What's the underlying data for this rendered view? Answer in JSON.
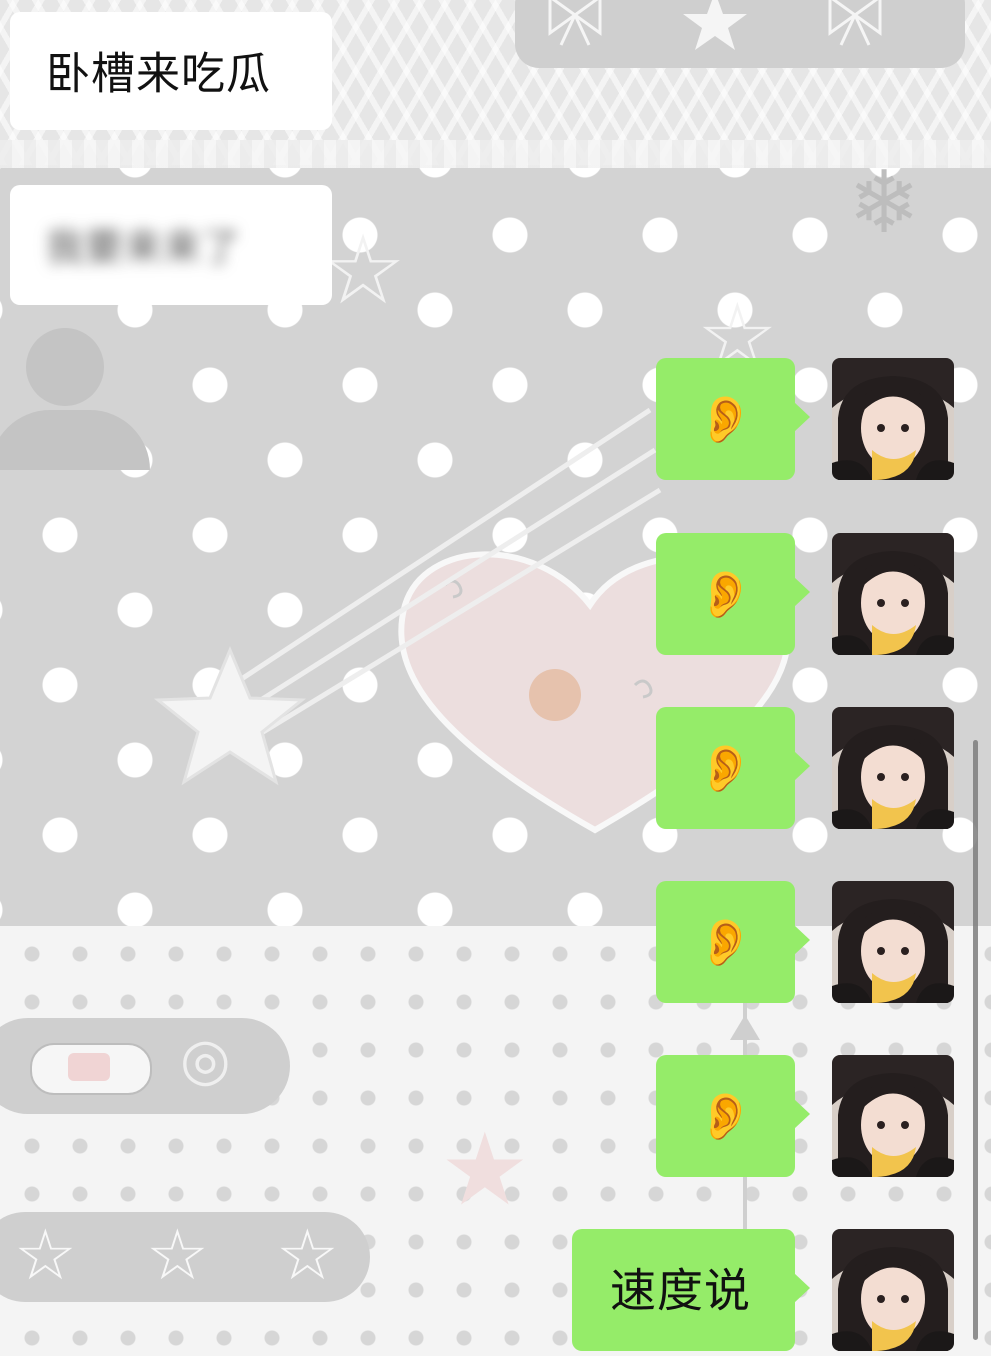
{
  "messages": [
    {
      "side": "left",
      "text": "卧槽来吃瓜",
      "blurred": false
    },
    {
      "side": "left",
      "text": "我要来来了",
      "blurred": true
    },
    {
      "side": "right",
      "emoji": "👂",
      "emoji_name": "ear"
    },
    {
      "side": "right",
      "emoji": "👂",
      "emoji_name": "ear"
    },
    {
      "side": "right",
      "emoji": "👂",
      "emoji_name": "ear"
    },
    {
      "side": "right",
      "emoji": "👂",
      "emoji_name": "ear"
    },
    {
      "side": "right",
      "emoji": "👂",
      "emoji_name": "ear"
    },
    {
      "side": "right",
      "text": "速度说"
    }
  ],
  "colors": {
    "outgoing_bubble": "#95ec69",
    "incoming_bubble": "#ffffff"
  },
  "avatar_icon": "girl-photo-avatar"
}
